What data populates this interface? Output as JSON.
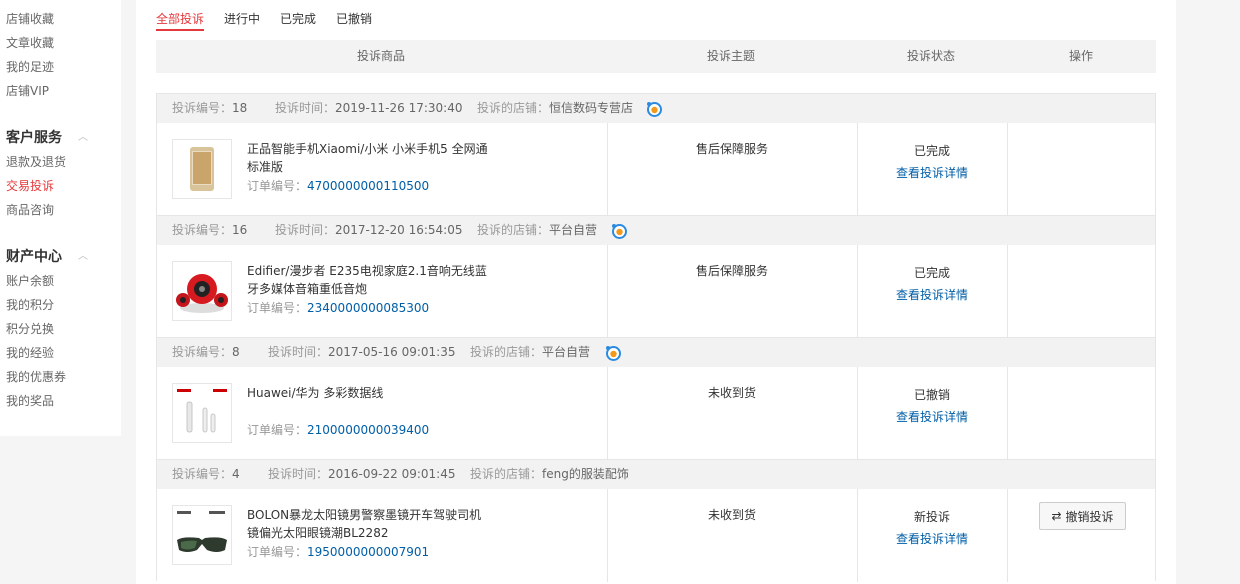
{
  "sidebar": {
    "top_items": [
      "店铺收藏",
      "文章收藏",
      "我的足迹",
      "店铺VIP"
    ],
    "sections": [
      {
        "title": "客户服务",
        "items": [
          "退款及退货",
          "交易投诉",
          "商品咨询"
        ],
        "active_index": 1
      },
      {
        "title": "财产中心",
        "items": [
          "账户余额",
          "我的积分",
          "积分兑换",
          "我的经验",
          "我的优惠券",
          "我的奖品"
        ]
      }
    ]
  },
  "tabs": [
    "全部投诉",
    "进行中",
    "已完成",
    "已撤销"
  ],
  "active_tab": 0,
  "table": {
    "headers": [
      "投诉商品",
      "投诉主题",
      "投诉状态",
      "操作"
    ]
  },
  "labels": {
    "complaint_no": "投诉编号：",
    "complaint_time": "投诉时间：",
    "shop": "投诉的店铺：",
    "order_no": "订单编号：",
    "view_detail": "查看投诉详情",
    "cancel_button": "撤销投诉"
  },
  "complaints": [
    {
      "id": "18",
      "time": "2019-11-26 17:30:40",
      "shop": "恒信数码专营店",
      "product_line1": "正品智能手机Xiaomi/小米 小米手机5 全网通",
      "product_line2": "标准版",
      "order_no": "4700000000110500",
      "topic": "售后保障服务",
      "status": "已完成"
    },
    {
      "id": "16",
      "time": "2017-12-20 16:54:05",
      "shop": "平台自营",
      "product_line1": "Edifier/漫步者 E235电视家庭2.1音响无线蓝",
      "product_line2": "牙多媒体音箱重低音炮",
      "order_no": "2340000000085300",
      "topic": "售后保障服务",
      "status": "已完成"
    },
    {
      "id": "8",
      "time": "2017-05-16 09:01:35",
      "shop": "平台自营",
      "product_line1": "Huawei/华为 多彩数据线",
      "product_line2": "",
      "order_no": "2100000000039400",
      "topic": "未收到货",
      "status": "已撤销"
    },
    {
      "id": "4",
      "time": "2016-09-22 09:01:45",
      "shop": "feng的服装配饰",
      "product_line1": "BOLON暴龙太阳镜男警察墨镜开车驾驶司机",
      "product_line2": "镜偏光太阳眼镜潮BL2282",
      "order_no": "1950000000007901",
      "topic": "未收到货",
      "status": "新投诉"
    }
  ],
  "colors": {
    "accent": "#e4393c",
    "link": "#005ea7"
  }
}
